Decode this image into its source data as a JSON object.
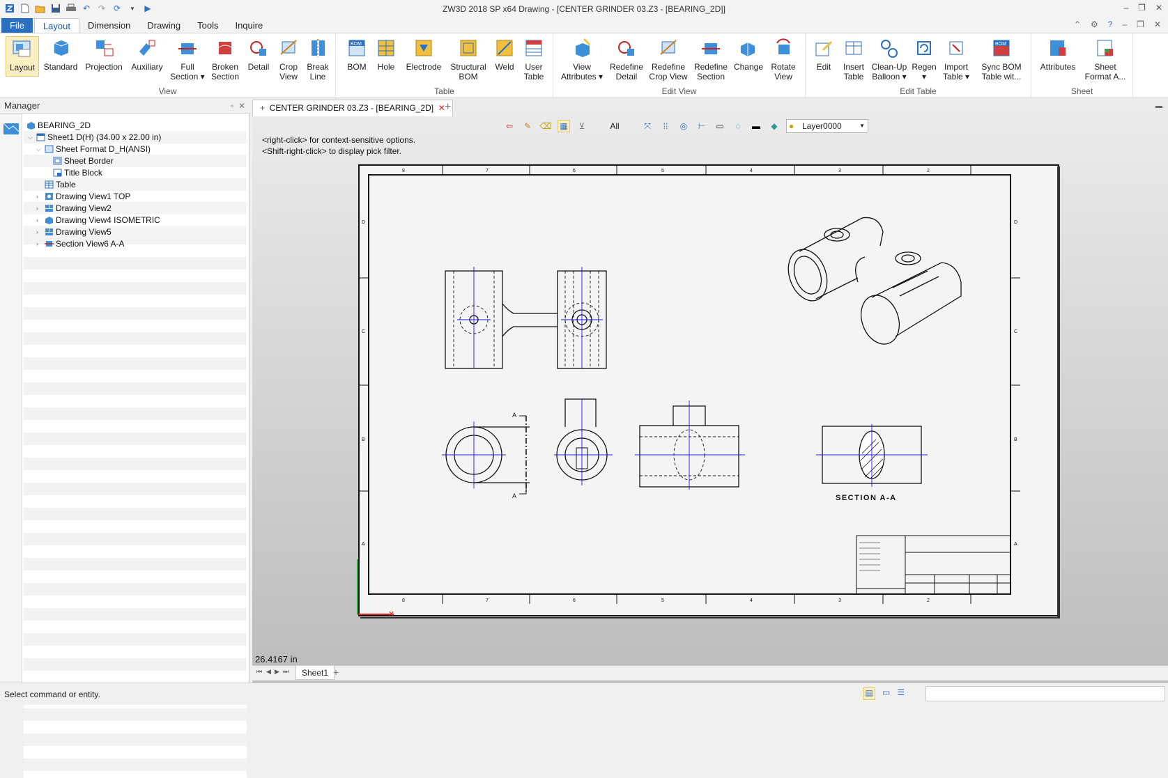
{
  "window": {
    "title": "ZW3D 2018 SP x64      Drawing - [CENTER GRINDER 03.Z3 - [BEARING_2D]]"
  },
  "menu": [
    "File",
    "Layout",
    "Dimension",
    "Drawing",
    "Tools",
    "Inquire"
  ],
  "ribbon": {
    "groups": [
      {
        "label": "View"
      },
      {
        "label": "Table"
      },
      {
        "label": "Edit View"
      },
      {
        "label": "Edit Table"
      },
      {
        "label": "Sheet"
      }
    ],
    "view_buttons": [
      {
        "line1": "Layout",
        "line2": ""
      },
      {
        "line1": "Standard",
        "line2": ""
      },
      {
        "line1": "Projection",
        "line2": ""
      },
      {
        "line1": "Auxiliary",
        "line2": ""
      },
      {
        "line1": "Full",
        "line2": "Section ▾"
      },
      {
        "line1": "Broken",
        "line2": "Section"
      },
      {
        "line1": "Detail",
        "line2": ""
      },
      {
        "line1": "Crop",
        "line2": "View"
      },
      {
        "line1": "Break",
        "line2": "Line"
      }
    ],
    "table_buttons": [
      {
        "line1": "BOM",
        "line2": ""
      },
      {
        "line1": "Hole",
        "line2": ""
      },
      {
        "line1": "Electrode",
        "line2": ""
      },
      {
        "line1": "Structural",
        "line2": "BOM"
      },
      {
        "line1": "Weld",
        "line2": ""
      },
      {
        "line1": "User",
        "line2": "Table"
      }
    ],
    "editview_buttons": [
      {
        "line1": "View",
        "line2": "Attributes ▾"
      },
      {
        "line1": "Redefine",
        "line2": "Detail"
      },
      {
        "line1": "Redefine",
        "line2": "Crop View"
      },
      {
        "line1": "Redefine",
        "line2": "Section"
      },
      {
        "line1": "Change",
        "line2": ""
      },
      {
        "line1": "Rotate",
        "line2": "View"
      }
    ],
    "edittable_buttons": [
      {
        "line1": "Edit",
        "line2": ""
      },
      {
        "line1": "Insert",
        "line2": "Table"
      },
      {
        "line1": "Clean-Up",
        "line2": "Balloon ▾"
      },
      {
        "line1": "Regen",
        "line2": "▾"
      },
      {
        "line1": "Import",
        "line2": "Table ▾"
      },
      {
        "line1": "Sync BOM",
        "line2": "Table wit..."
      }
    ],
    "sheet_buttons": [
      {
        "line1": "Attributes",
        "line2": ""
      },
      {
        "line1": "Sheet",
        "line2": "Format A..."
      }
    ],
    "bom_icon_text": "BOM"
  },
  "manager": {
    "title": "Manager",
    "tree": [
      {
        "label": "BEARING_2D",
        "indent": 0,
        "expander": ""
      },
      {
        "label": "Sheet1 D(H) (34.00 x 22.00 in)",
        "indent": 1,
        "expander": "v"
      },
      {
        "label": "Sheet Format D_H(ANSI)",
        "indent": 2,
        "expander": "v"
      },
      {
        "label": "Sheet Border",
        "indent": 3,
        "expander": ""
      },
      {
        "label": "Title Block",
        "indent": 3,
        "expander": ""
      },
      {
        "label": "Table",
        "indent": 2,
        "expander": ""
      },
      {
        "label": "Drawing View1 TOP",
        "indent": 2,
        "expander": ">"
      },
      {
        "label": "Drawing View2",
        "indent": 2,
        "expander": ">"
      },
      {
        "label": "Drawing View4 ISOMETRIC",
        "indent": 2,
        "expander": ">"
      },
      {
        "label": "Drawing View5",
        "indent": 2,
        "expander": ">"
      },
      {
        "label": "Section View6 A-A",
        "indent": 2,
        "expander": ">"
      }
    ]
  },
  "document": {
    "tab_label": "CENTER GRINDER 03.Z3 - [BEARING_2D]",
    "filter_label": "All",
    "layer": "Layer0000",
    "hint_line1": "<right-click> for context-sensitive options.",
    "hint_line2": "<Shift-right-click> to display pick filter.",
    "section_label": "SECTION A-A",
    "section_marker": "A",
    "coordinate": "26.4167 in",
    "sheet_tab": "Sheet1",
    "zone_numbers": [
      "8",
      "7",
      "6",
      "5",
      "4",
      "3",
      "2"
    ],
    "zone_letters": [
      "D",
      "C",
      "B",
      "A"
    ]
  },
  "status": {
    "text": "Select command or entity."
  },
  "colors": {
    "accent": "#2b6fc0",
    "centerline": "#1a1adc",
    "axis_x": "#e02020",
    "axis_y": "#20b020"
  }
}
